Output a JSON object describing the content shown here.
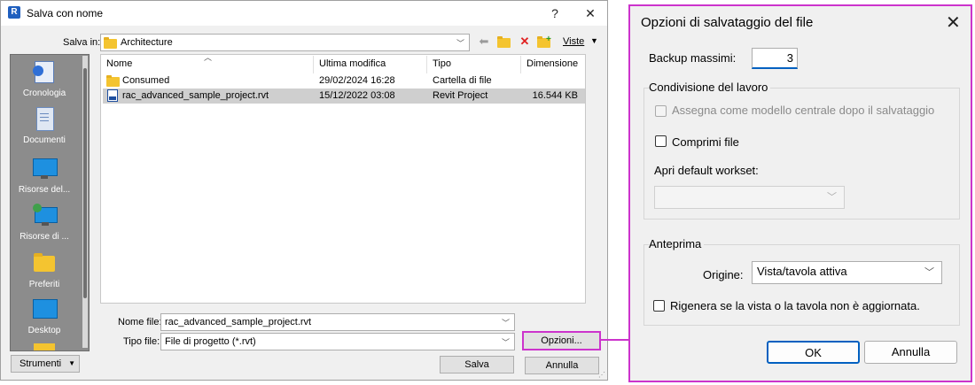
{
  "colors": {
    "accent": "#cc33cc",
    "selected_row": "#cfcfcf",
    "places_bg": "#8c8c8c"
  },
  "save_dialog": {
    "title": "Salva con nome",
    "help_label": "?",
    "close_label": "✕",
    "save_in_label": "Salva in:",
    "save_in_value": "Architecture",
    "views_label": "Viste",
    "places": [
      "Cronologia",
      "Documenti",
      "Risorse del...",
      "Risorse di ...",
      "Preferiti",
      "Desktop"
    ],
    "columns": [
      "Nome",
      "Ultima modifica",
      "Tipo",
      "Dimensione"
    ],
    "files": [
      {
        "name": "Consumed",
        "modified": "29/02/2024 16:28",
        "type": "Cartella di file",
        "size": "",
        "icon": "folder-icon"
      },
      {
        "name": "rac_advanced_sample_project.rvt",
        "modified": "15/12/2022 03:08",
        "type": "Revit Project",
        "size": "16.544 KB",
        "icon": "rvt-file-icon"
      }
    ],
    "filename_label": "Nome file:",
    "filename_value": "rac_advanced_sample_project.rvt",
    "filetype_label": "Tipo file:",
    "filetype_value": "File di progetto (*.rvt)",
    "tools_label": "Strumenti",
    "options_label": "Opzioni...",
    "save_label": "Salva",
    "cancel_label": "Annulla"
  },
  "options_dialog": {
    "title": "Opzioni di salvataggio del file",
    "close_label": "✕",
    "max_backups_label": "Backup massimi:",
    "max_backups_value": "3",
    "worksharing": {
      "group_label": "Condivisione del lavoro",
      "central_label": "Assegna come modello centrale dopo il salvataggio",
      "compress_label": "Comprimi file",
      "open_workset_label": "Apri default workset:",
      "open_workset_value": ""
    },
    "preview": {
      "group_label": "Anteprima",
      "source_label": "Origine:",
      "source_value": "Vista/tavola attiva",
      "regenerate_label": "Rigenera se la vista o la tavola non è aggiornata."
    },
    "ok_label": "OK",
    "cancel_label": "Annulla"
  }
}
